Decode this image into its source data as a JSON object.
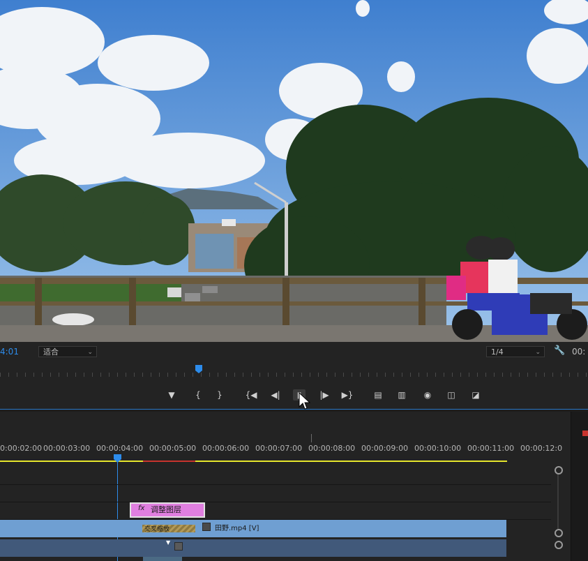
{
  "viewer": {
    "timecode": "4:01",
    "fit_label": "适合",
    "quality_label": "1/4",
    "right_timecode": "00:"
  },
  "transport": {
    "buttons": [
      "add-marker",
      "mark-in",
      "mark-out",
      "go-to-in",
      "step-back",
      "play",
      "step-forward",
      "go-to-out",
      "lift",
      "extract",
      "export-frame",
      "insert",
      "overwrite"
    ]
  },
  "timeline": {
    "ruler_labels": [
      "0:00:02:00",
      "00:00:03:00",
      "00:00:04:00",
      "00:00:05:00",
      "00:00:06:00",
      "00:00:07:00",
      "00:00:08:00",
      "00:00:09:00",
      "00:00:10:00",
      "00:00:11:00",
      "00:00:12:0"
    ],
    "adjustment_clip_label": "调整图层",
    "video_clip_label": "田野.mp4 [V]",
    "transition_label": "交叉缩放",
    "fx_label": "fx"
  },
  "colors": {
    "accent": "#2d8ceb",
    "adjustment_clip": "#e07fe0",
    "video_clip": "#6f9fd2",
    "work_area": "#e6e62c",
    "render_bar": "#c8342e"
  }
}
